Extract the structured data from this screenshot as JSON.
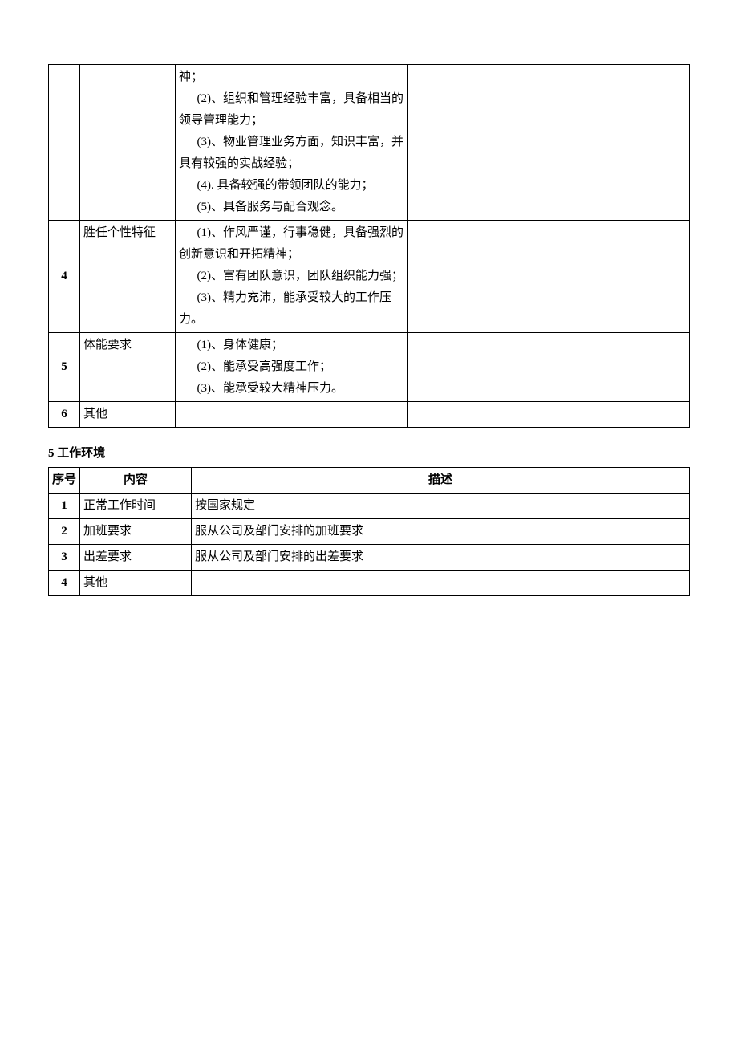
{
  "t1": {
    "r3": {
      "num": "",
      "cat": "",
      "req": "神；\n(2)、组织和管理经验丰富，具备相当的领导管理能力；\n(3)、物业管理业务方面，知识丰富，并具有较强的实战经验；\n(4). 具备较强的带领团队的能力；\n(5)、具备服务与配合观念。",
      "rem": ""
    },
    "r4": {
      "num": "4",
      "cat": "胜任个性特征",
      "req": "(1)、作风严谨，行事稳健，具备强烈的创新意识和开拓精神；\n(2)、富有团队意识，团队组织能力强；\n(3)、精力充沛，能承受较大的工作压力。",
      "rem": ""
    },
    "r5": {
      "num": "5",
      "cat": "体能要求",
      "req": "(1)、身体健康；\n(2)、能承受高强度工作；\n(3)、能承受较大精神压力。",
      "rem": ""
    },
    "r6": {
      "num": "6",
      "cat": "其他",
      "req": "",
      "rem": ""
    }
  },
  "sec": "5 工作环境",
  "t2": {
    "h": {
      "c1": "序号",
      "c2": "内容",
      "c3": "描述"
    },
    "r1": {
      "num": "1",
      "c": "正常工作时间",
      "d": "按国家规定"
    },
    "r2": {
      "num": "2",
      "c": "加班要求",
      "d": "服从公司及部门安排的加班要求"
    },
    "r3": {
      "num": "3",
      "c": "出差要求",
      "d": "服从公司及部门安排的出差要求"
    },
    "r4": {
      "num": "4",
      "c": "其他",
      "d": ""
    }
  }
}
